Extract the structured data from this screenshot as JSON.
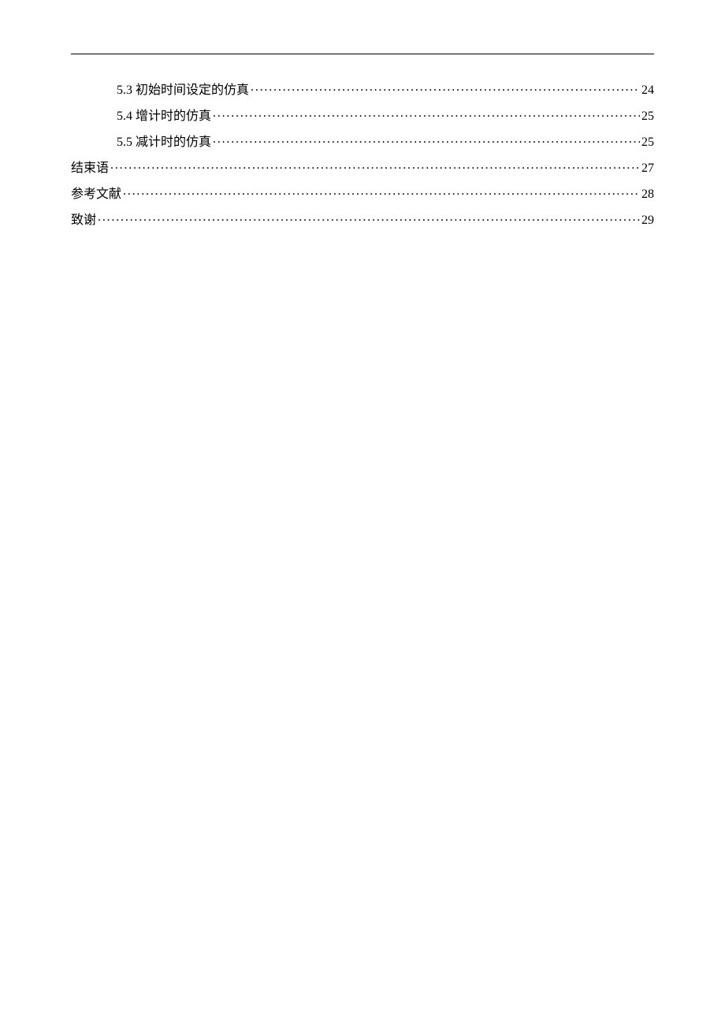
{
  "toc": {
    "entries": [
      {
        "indent": true,
        "label": "5.3  初始时间设定的仿真",
        "page": "24"
      },
      {
        "indent": true,
        "label": "5.4  增计时的仿真",
        "page": "25"
      },
      {
        "indent": true,
        "label": "5.5  减计时的仿真",
        "page": "25"
      },
      {
        "indent": false,
        "label": "结束语",
        "page": "27"
      },
      {
        "indent": false,
        "label": "参考文献",
        "page": "28"
      },
      {
        "indent": false,
        "label": "致谢",
        "page": "29"
      }
    ]
  }
}
